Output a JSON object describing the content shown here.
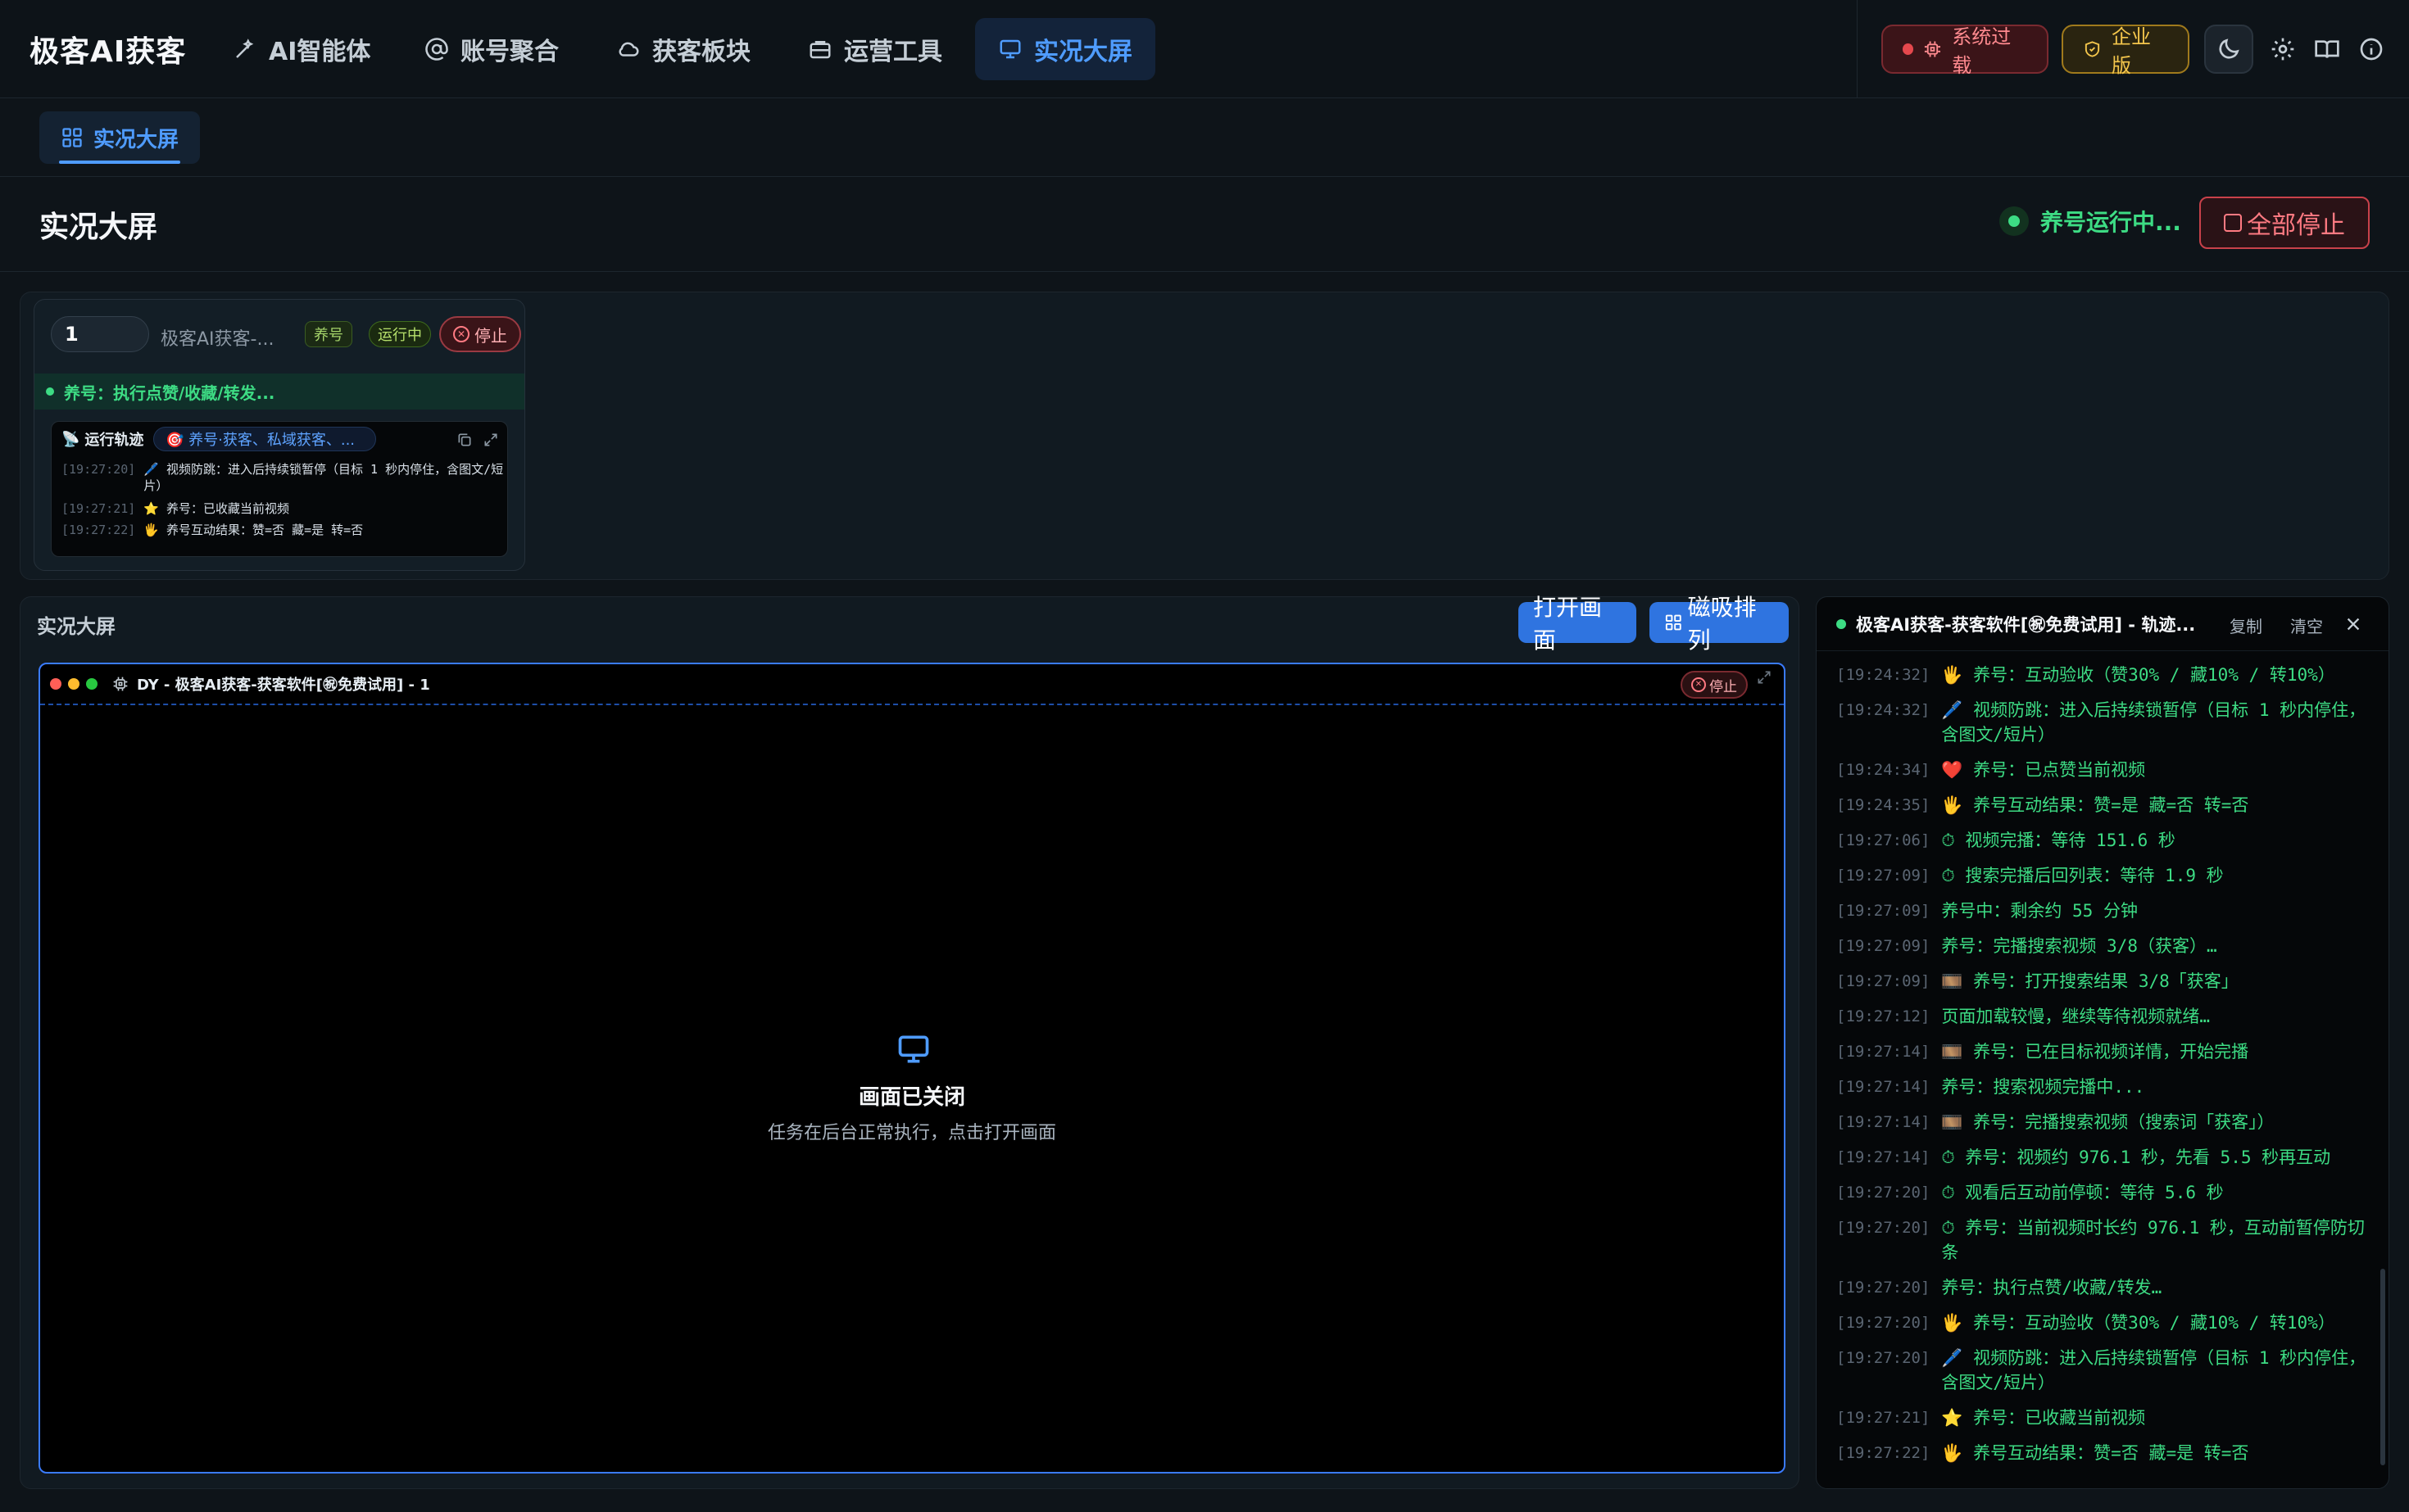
{
  "brand": "极客AI获客",
  "nav": {
    "items": [
      {
        "label": "AI智能体",
        "icon": "wand-icon"
      },
      {
        "label": "账号聚合",
        "icon": "at-sign-icon"
      },
      {
        "label": "获客板块",
        "icon": "cloud-icon"
      },
      {
        "label": "运营工具",
        "icon": "toolbox-icon"
      },
      {
        "label": "实况大屏",
        "icon": "monitor-icon",
        "active": true
      }
    ]
  },
  "header_actions": {
    "system_status": "系统过载",
    "edition": "企业版"
  },
  "subtab": {
    "label": "实况大屏"
  },
  "page": {
    "title": "实况大屏",
    "run_status": "养号运行中...",
    "stop_all": "全部停止"
  },
  "account_card": {
    "number": "1",
    "name": "极客AI获客-...",
    "tag_mode": "养号",
    "tag_state": "运行中",
    "stop_label": "停止",
    "status_line": "养号：执行点赞/收藏/转发...",
    "trail_label": "运行轨迹",
    "trail_chip": "🎯 养号·获客、私域获客、...",
    "trail_lines": [
      {
        "ts": "[19:27:20]",
        "msg": "🖊️ 视频防跳：进入后持续锁暂停（目标 1 秒内停住，含图文/短片）"
      },
      {
        "ts": "[19:27:21]",
        "msg": "⭐ 养号：已收藏当前视频"
      },
      {
        "ts": "[19:27:22]",
        "msg": "🖐️ 养号互动结果：赞=否 藏=是 转=否"
      }
    ]
  },
  "live": {
    "title": "实况大屏",
    "open_button": "打开画面",
    "snap_button": "磁吸排列",
    "screen_title": "DY - 极客AI获客-获客软件[㊗免费试用] - 1",
    "screen_stop": "停止",
    "closed_title": "画面已关闭",
    "closed_sub": "任务在后台正常执行，点击打开画面"
  },
  "log": {
    "title": "极客AI获客-获客软件[㊗免费试用] - 轨迹...",
    "copy": "复制",
    "clear": "清空",
    "lines": [
      {
        "ts": "[19:24:32]",
        "msg": "🖐️ 养号：互动验收（赞30% / 藏10% / 转10%）"
      },
      {
        "ts": "[19:24:32]",
        "msg": "🖊️ 视频防跳：进入后持续锁暂停（目标 1 秒内停住，含图文/短片）"
      },
      {
        "ts": "[19:24:34]",
        "msg": "❤️ 养号：已点赞当前视频"
      },
      {
        "ts": "[19:24:35]",
        "msg": "🖐️ 养号互动结果：赞=是 藏=否 转=否"
      },
      {
        "ts": "[19:27:06]",
        "msg": "⏱ 视频完播：等待 151.6 秒"
      },
      {
        "ts": "[19:27:09]",
        "msg": "⏱ 搜索完播后回列表：等待 1.9 秒"
      },
      {
        "ts": "[19:27:09]",
        "msg": "养号中：剩余约 55 分钟"
      },
      {
        "ts": "[19:27:09]",
        "msg": "养号：完播搜索视频 3/8（获客）…"
      },
      {
        "ts": "[19:27:09]",
        "msg": "🎞️ 养号：打开搜索结果 3/8「获客」"
      },
      {
        "ts": "[19:27:12]",
        "msg": "页面加载较慢，继续等待视频就绪…"
      },
      {
        "ts": "[19:27:14]",
        "msg": "🎞️ 养号：已在目标视频详情，开始完播"
      },
      {
        "ts": "[19:27:14]",
        "msg": "养号：搜索视频完播中..."
      },
      {
        "ts": "[19:27:14]",
        "msg": "🎞️ 养号：完播搜索视频（搜索词「获客」）"
      },
      {
        "ts": "[19:27:14]",
        "msg": "⏱ 养号：视频约 976.1 秒，先看 5.5 秒再互动"
      },
      {
        "ts": "[19:27:20]",
        "msg": "⏱ 观看后互动前停顿：等待 5.6 秒"
      },
      {
        "ts": "[19:27:20]",
        "msg": "⏱ 养号：当前视频时长约 976.1 秒，互动前暂停防切条"
      },
      {
        "ts": "[19:27:20]",
        "msg": "养号：执行点赞/收藏/转发…"
      },
      {
        "ts": "[19:27:20]",
        "msg": "🖐️ 养号：互动验收（赞30% / 藏10% / 转10%）"
      },
      {
        "ts": "[19:27:20]",
        "msg": "🖊️ 视频防跳：进入后持续锁暂停（目标 1 秒内停住，含图文/短片）"
      },
      {
        "ts": "[19:27:21]",
        "msg": "⭐ 养号：已收藏当前视频"
      },
      {
        "ts": "[19:27:22]",
        "msg": "🖐️ 养号互动结果：赞=否 藏=是 转=否"
      }
    ]
  }
}
